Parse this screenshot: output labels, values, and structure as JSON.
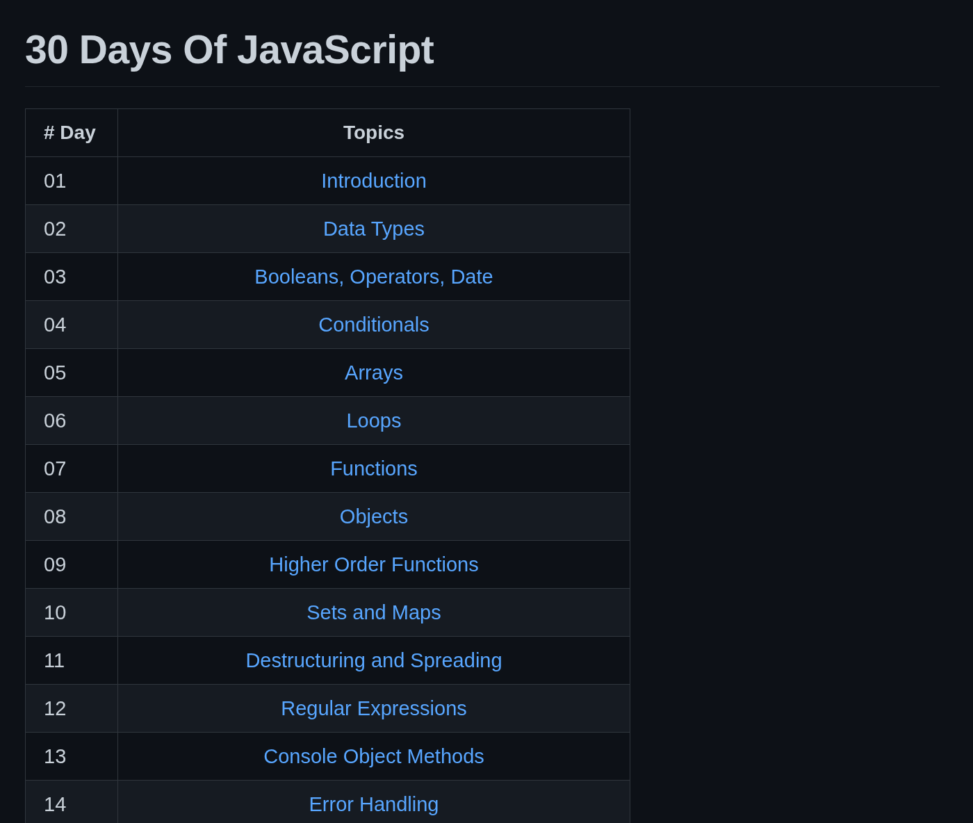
{
  "title": "30 Days Of JavaScript",
  "table": {
    "columns": [
      "# Day",
      "Topics"
    ],
    "rows": [
      {
        "day": "01",
        "topic": "Introduction"
      },
      {
        "day": "02",
        "topic": "Data Types"
      },
      {
        "day": "03",
        "topic": "Booleans, Operators, Date"
      },
      {
        "day": "04",
        "topic": "Conditionals"
      },
      {
        "day": "05",
        "topic": "Arrays"
      },
      {
        "day": "06",
        "topic": "Loops"
      },
      {
        "day": "07",
        "topic": "Functions"
      },
      {
        "day": "08",
        "topic": "Objects"
      },
      {
        "day": "09",
        "topic": "Higher Order Functions"
      },
      {
        "day": "10",
        "topic": "Sets and Maps"
      },
      {
        "day": "11",
        "topic": "Destructuring and Spreading"
      },
      {
        "day": "12",
        "topic": "Regular Expressions"
      },
      {
        "day": "13",
        "topic": "Console Object Methods"
      },
      {
        "day": "14",
        "topic": "Error Handling"
      }
    ]
  }
}
